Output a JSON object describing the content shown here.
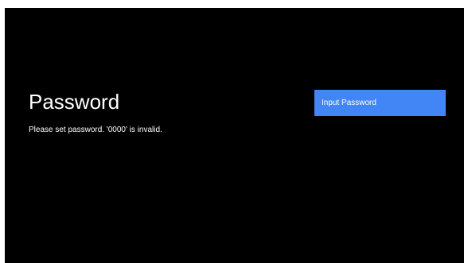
{
  "screen": {
    "title": "Password",
    "message": "Please set password. '0000' is invalid."
  },
  "actions": {
    "input_password_label": "Input Password"
  },
  "colors": {
    "background": "#000000",
    "accent": "#4285f4",
    "text": "#ffffff"
  }
}
